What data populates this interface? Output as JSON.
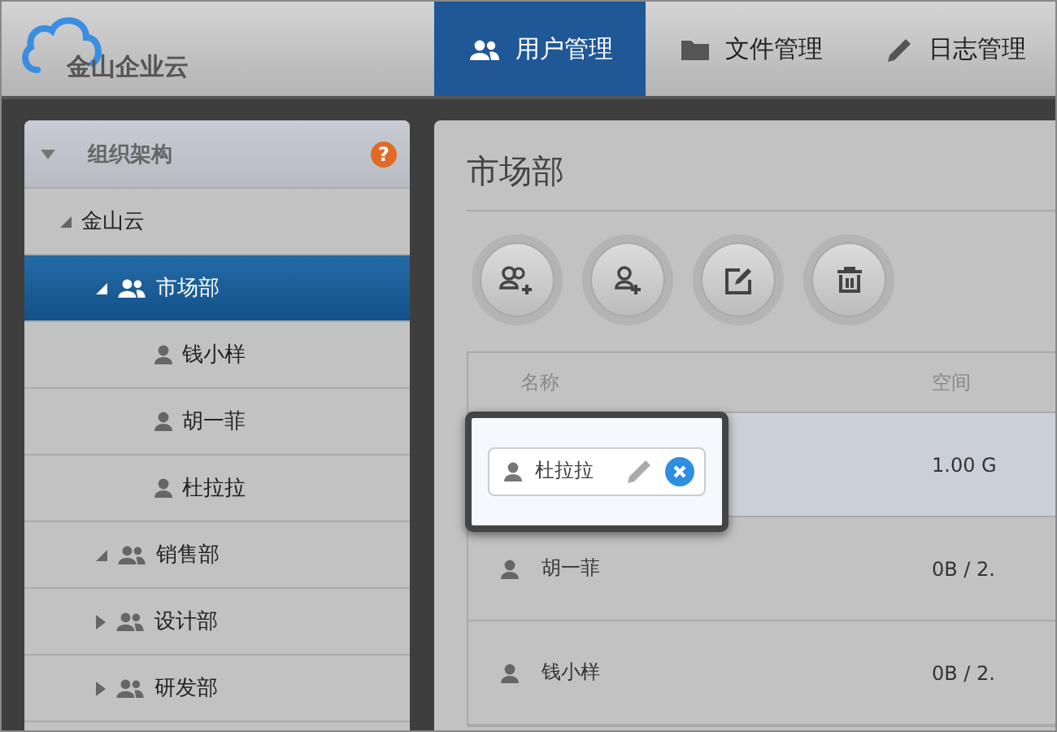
{
  "logo": {
    "text": "金山企业云"
  },
  "tabs": [
    {
      "label": "用户管理",
      "selected": true
    },
    {
      "label": "文件管理",
      "selected": false
    },
    {
      "label": "日志管理",
      "selected": false
    }
  ],
  "sidebar": {
    "title": "组织架构",
    "help": "?",
    "tree": [
      {
        "label": "金山云",
        "kind": "root",
        "expanded": true,
        "selected": false,
        "children": [
          {
            "label": "市场部",
            "kind": "group",
            "expanded": true,
            "selected": true,
            "children": [
              {
                "label": "钱小样",
                "kind": "user",
                "selected": false
              },
              {
                "label": "胡一菲",
                "kind": "user",
                "selected": false
              },
              {
                "label": "杜拉拉",
                "kind": "user",
                "selected": false
              }
            ]
          },
          {
            "label": "销售部",
            "kind": "group",
            "expanded": true,
            "selected": false
          },
          {
            "label": "设计部",
            "kind": "group",
            "expanded": false,
            "selected": false
          },
          {
            "label": "研发部",
            "kind": "group",
            "expanded": false,
            "selected": false
          }
        ]
      }
    ]
  },
  "main": {
    "title": "市场部",
    "table": {
      "columns": [
        "名称",
        "空间"
      ],
      "rows": [
        {
          "name": "杜拉拉",
          "space": "1.00 G",
          "selected": true,
          "editing": true
        },
        {
          "name": "胡一菲",
          "space": "0B / 2.",
          "selected": false,
          "editing": false
        },
        {
          "name": "钱小样",
          "space": "0B / 2.",
          "selected": false,
          "editing": false
        }
      ]
    }
  }
}
